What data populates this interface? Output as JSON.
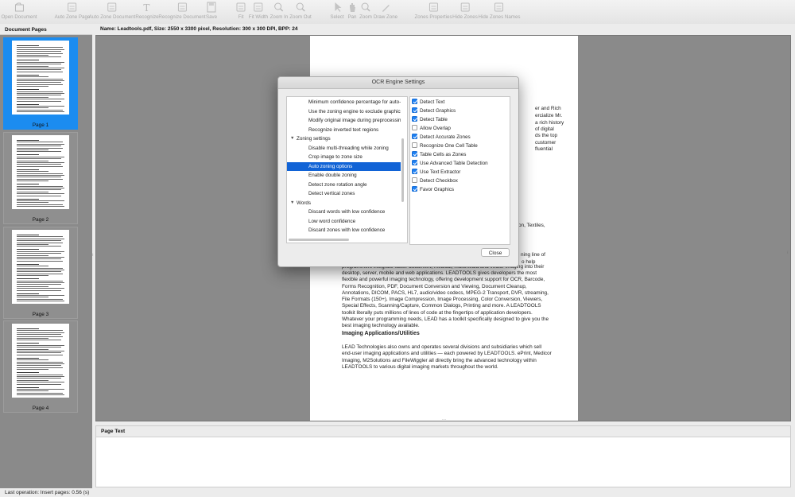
{
  "toolbar": {
    "items": [
      {
        "label": "Open Document",
        "icon": "open-document-icon"
      },
      {
        "label": "Auto Zone Page",
        "icon": "auto-zone-page-icon"
      },
      {
        "label": "Auto Zone Document",
        "icon": "auto-zone-document-icon"
      },
      {
        "label": "Recognize",
        "icon": "recognize-icon"
      },
      {
        "label": "Recognize Document",
        "icon": "recognize-document-icon"
      },
      {
        "label": "Save",
        "icon": "save-icon"
      },
      {
        "label": "Fit",
        "icon": "fit-icon"
      },
      {
        "label": "Fit Width",
        "icon": "fit-width-icon"
      },
      {
        "label": "Zoom In",
        "icon": "zoom-in-icon"
      },
      {
        "label": "Zoom Out",
        "icon": "zoom-out-icon"
      },
      {
        "label": "Select",
        "icon": "select-icon"
      },
      {
        "label": "Pan",
        "icon": "pan-icon"
      },
      {
        "label": "Zoom",
        "icon": "zoom-icon"
      },
      {
        "label": "Draw Zone",
        "icon": "draw-zone-icon"
      },
      {
        "label": "Zones Properties",
        "icon": "zones-properties-icon"
      },
      {
        "label": "Hide Zones",
        "icon": "hide-zones-icon"
      },
      {
        "label": "Hide Zones Names",
        "icon": "hide-zones-names-icon"
      }
    ]
  },
  "sidebar": {
    "title": "Document Pages",
    "pages": [
      {
        "label": "Page 1",
        "selected": true
      },
      {
        "label": "Page 2",
        "selected": false
      },
      {
        "label": "Page 3",
        "selected": false
      },
      {
        "label": "Page 4",
        "selected": false
      }
    ]
  },
  "info": {
    "text": "Name: Leadtools.pdf, Size: 2550 x 3300 pixel, Resolution: 300 x 300 DPI, BPP: 24"
  },
  "document": {
    "fragments": [
      "er and Rich",
      "ercialize Mr.",
      "a rich history",
      "of digital",
      "ds the top",
      "customer",
      "fluential",
      "on, Textiles,",
      "ning line of",
      "o help",
      "programmers integrate faster document, medical, multimedia and vector imaging into their"
    ],
    "paragraph1": "desktop, server, mobile and web applications. LEADTOOLS gives developers the most flexible and powerful imaging technology, offering development support for OCR, Barcode, Forms Recognition, PDF, Document Conversion and Viewing, Document Cleanup, Annotations, DICOM, PACS, HL7, audio/video codecs, MPEG-2 Transport, DVR, streaming, File Formats (150+), Image Compression, Image Processing, Color Conversion, Viewers, Special Effects, Scanning/Capture, Common Dialogs, Printing and more. A LEADTOOLS toolkit literally puts millions of lines of code at the fingertips of application developers. Whatever your programming needs, LEAD has a toolkit specifically designed to give you the best imaging technology available.",
    "heading": "Imaging Applications/Utilities",
    "paragraph2": "LEAD Technologies also owns and operates several divisions and subsidiaries which sell end-user imaging applications and utilities — each powered by LEADTOOLS. ePrint, Medicor Imaging, M2Solutions and FileWiggler all directly bring the advanced technology within LEADTOOLS to various digital imaging markets throughout the world."
  },
  "page_text": {
    "title": "Page Text"
  },
  "status": {
    "text": "Last operation: Insert pages: 0.56 (s)"
  },
  "dialog": {
    "title": "OCR Engine Settings",
    "tree": [
      {
        "label": "Minimum confidence percentage for auto-r",
        "level": "child",
        "selected": false
      },
      {
        "label": "Use the zoning engine to exclude graphics",
        "level": "child",
        "selected": false
      },
      {
        "label": "Modify original image during preprocessin",
        "level": "child",
        "selected": false
      },
      {
        "label": "Recognize inverted text regions",
        "level": "child",
        "selected": false
      },
      {
        "label": "Zoning settings",
        "level": "group",
        "selected": false
      },
      {
        "label": "Disable multi-threading while zoning",
        "level": "child",
        "selected": false
      },
      {
        "label": "Crop image to zone size",
        "level": "child",
        "selected": false
      },
      {
        "label": "Auto zoning options",
        "level": "child",
        "selected": true
      },
      {
        "label": "Enable double zoning",
        "level": "child",
        "selected": false
      },
      {
        "label": "Detect zone rotation angle",
        "level": "child",
        "selected": false
      },
      {
        "label": "Detect vertical zones",
        "level": "child",
        "selected": false
      },
      {
        "label": "Words",
        "level": "group",
        "selected": false
      },
      {
        "label": "Discard words with low confidence",
        "level": "child",
        "selected": false
      },
      {
        "label": "Low word confidence",
        "level": "child",
        "selected": false
      },
      {
        "label": "Discard zones with low confidence",
        "level": "child",
        "selected": false
      }
    ],
    "options": [
      {
        "label": "Detect Text",
        "checked": true
      },
      {
        "label": "Detect Graphics",
        "checked": true
      },
      {
        "label": "Detect Table",
        "checked": true
      },
      {
        "label": "Allow Overlap",
        "checked": false
      },
      {
        "label": "Detect Accurate Zones",
        "checked": true
      },
      {
        "label": "Recognize One Cell Table",
        "checked": false
      },
      {
        "label": "Table Cells as Zones",
        "checked": true
      },
      {
        "label": "Use Advanced Table Detection",
        "checked": true
      },
      {
        "label": "Use Text Extractor",
        "checked": true
      },
      {
        "label": "Detect Checkbox",
        "checked": false
      },
      {
        "label": "Favor Graphics",
        "checked": true
      }
    ],
    "close_label": "Close"
  }
}
